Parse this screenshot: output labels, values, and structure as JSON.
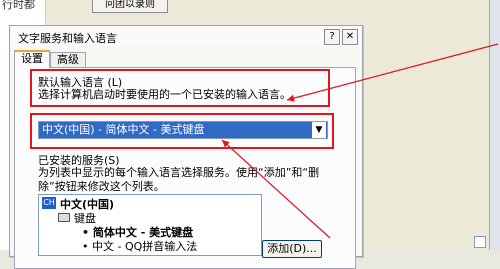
{
  "background": {
    "left_text": "行时都",
    "button_label": "问团以录则"
  },
  "dialog": {
    "title": "文字服务和输入语言",
    "help_glyph": "?",
    "close_glyph": "✕",
    "tabs": [
      {
        "label": "设置",
        "active": true
      },
      {
        "label": "高级",
        "active": false
      }
    ],
    "default_language": {
      "title": "默认输入语言 (L)",
      "description": "选择计算机启动时要使用的一个已安装的输入语言。",
      "selected_value": "中文(中国) - 简体中文 - 美式键盘"
    },
    "installed_services": {
      "title": "已安装的服务(S)",
      "description_line1": "为列表中显示的每个输入语言选择服务。使用“添加”和“删",
      "description_line2": "除”按钮来修改这个列表。",
      "language_badge": "CH",
      "language": "中文(中国)",
      "group": "键盘",
      "items": [
        {
          "label": "• 简体中文 - 美式键盘",
          "bold": true
        },
        {
          "label": "• 中文 - QQ拼音输入法",
          "bold": false
        }
      ]
    },
    "add_button": "添加(D)..."
  },
  "colors": {
    "highlight_box": "#e0151d",
    "selection": "#316ac5",
    "tab_accent": "#e8a33b"
  }
}
